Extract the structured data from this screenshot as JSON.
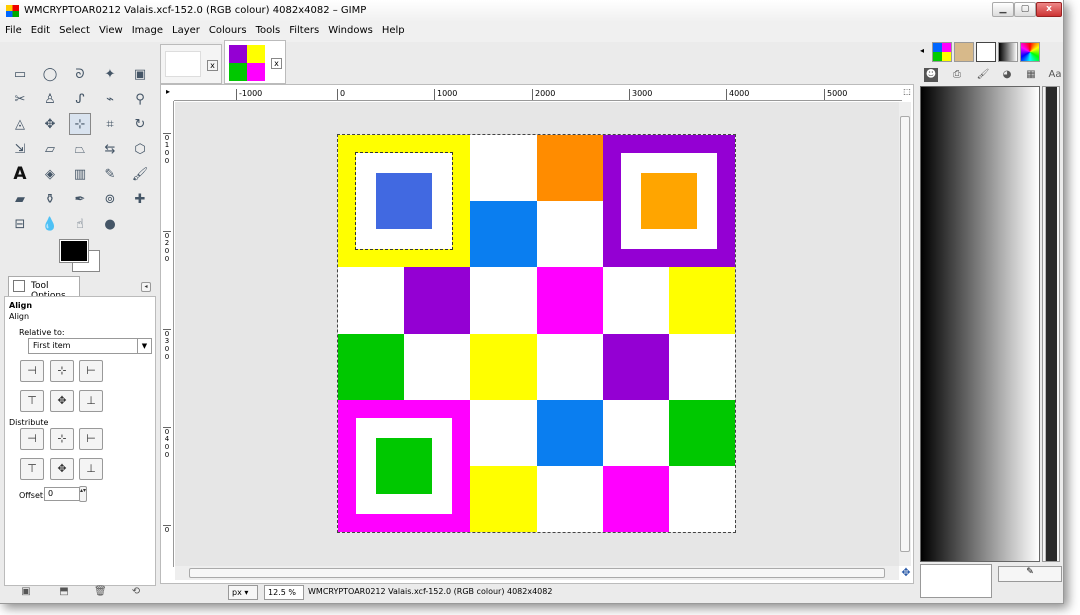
{
  "window": {
    "title": "WMCRYPTOAR0212 Valais.xcf-152.0 (RGB colour) 4082x4082 – GIMP",
    "min_glyph": "▁",
    "max_glyph": "▢",
    "close_glyph": "x"
  },
  "menu": [
    "File",
    "Edit",
    "Select",
    "View",
    "Image",
    "Layer",
    "Colours",
    "Tools",
    "Filters",
    "Windows",
    "Help"
  ],
  "toolbox": {
    "tools": [
      {
        "name": "rect-select-icon",
        "glyph": "▭"
      },
      {
        "name": "ellipse-select-icon",
        "glyph": "◯"
      },
      {
        "name": "free-select-icon",
        "glyph": "ᘐ"
      },
      {
        "name": "fuzzy-select-icon",
        "glyph": "✦"
      },
      {
        "name": "colour-select-icon",
        "glyph": "▣"
      },
      {
        "name": "scissors-select-icon",
        "glyph": "✂"
      },
      {
        "name": "foreground-select-icon",
        "glyph": "♙"
      },
      {
        "name": "paths-icon",
        "glyph": "ᔑ"
      },
      {
        "name": "colour-picker-icon",
        "glyph": "⌁"
      },
      {
        "name": "zoom-icon",
        "glyph": "⚲"
      },
      {
        "name": "measure-icon",
        "glyph": "◬"
      },
      {
        "name": "move-icon",
        "glyph": "✥"
      },
      {
        "name": "align-icon",
        "glyph": "⊹"
      },
      {
        "name": "crop-icon",
        "glyph": "⌗"
      },
      {
        "name": "rotate-icon",
        "glyph": "↻"
      },
      {
        "name": "scale-icon",
        "glyph": "⇲"
      },
      {
        "name": "shear-icon",
        "glyph": "▱"
      },
      {
        "name": "perspective-icon",
        "glyph": "⏢"
      },
      {
        "name": "flip-icon",
        "glyph": "⇆"
      },
      {
        "name": "cage-icon",
        "glyph": "⬡"
      },
      {
        "name": "text-icon",
        "glyph": "A"
      },
      {
        "name": "bucket-fill-icon",
        "glyph": "◈"
      },
      {
        "name": "blend-icon",
        "glyph": "▥"
      },
      {
        "name": "pencil-icon",
        "glyph": "✎"
      },
      {
        "name": "paintbrush-icon",
        "glyph": "🖌"
      },
      {
        "name": "eraser-icon",
        "glyph": "▰"
      },
      {
        "name": "airbrush-icon",
        "glyph": "⚱"
      },
      {
        "name": "ink-icon",
        "glyph": "✒"
      },
      {
        "name": "clone-icon",
        "glyph": "⊚"
      },
      {
        "name": "heal-icon",
        "glyph": "✚"
      },
      {
        "name": "perspective-clone-icon",
        "glyph": "⊟"
      },
      {
        "name": "blur-icon",
        "glyph": "💧"
      },
      {
        "name": "smudge-icon",
        "glyph": "☝"
      },
      {
        "name": "dodge-burn-icon",
        "glyph": "●"
      }
    ],
    "tool_options_tab": "Tool Options",
    "align_title": "Align",
    "align_sub": "Align",
    "relative_to_label": "Relative to:",
    "relative_to_value": "First item",
    "distribute_label": "Distribute",
    "offset_label": "Offset:",
    "offset_value": "0"
  },
  "image_tabs": [
    {
      "name": "blank-image-tab",
      "close": "x"
    },
    {
      "name": "checker-image-tab",
      "close": "x"
    }
  ],
  "rulers": {
    "h_ticks": [
      "-1000",
      "0",
      "1000",
      "2000",
      "3000",
      "4000",
      "5000"
    ],
    "v_ticks": [
      "0",
      "1",
      "0",
      "0",
      "0",
      "2",
      "0",
      "0",
      "0",
      "3",
      "0",
      "0",
      "0",
      "4",
      "0",
      "0",
      "0"
    ]
  },
  "status": {
    "unit": "px",
    "zoom": "12.5 %",
    "text": "WMCRYPTOAR0212 Valais.xcf-152.0 (RGB colour) 4082x4082"
  },
  "image_colors": {
    "yellow": "#ffff00",
    "blue": "#4169e1",
    "orange": "#ff8c00",
    "purple": "#9400d3",
    "gold": "#ffa500",
    "sky": "#0a7ef0",
    "magenta": "#ff00ff",
    "green": "#00c800",
    "white": "#ffffff"
  }
}
